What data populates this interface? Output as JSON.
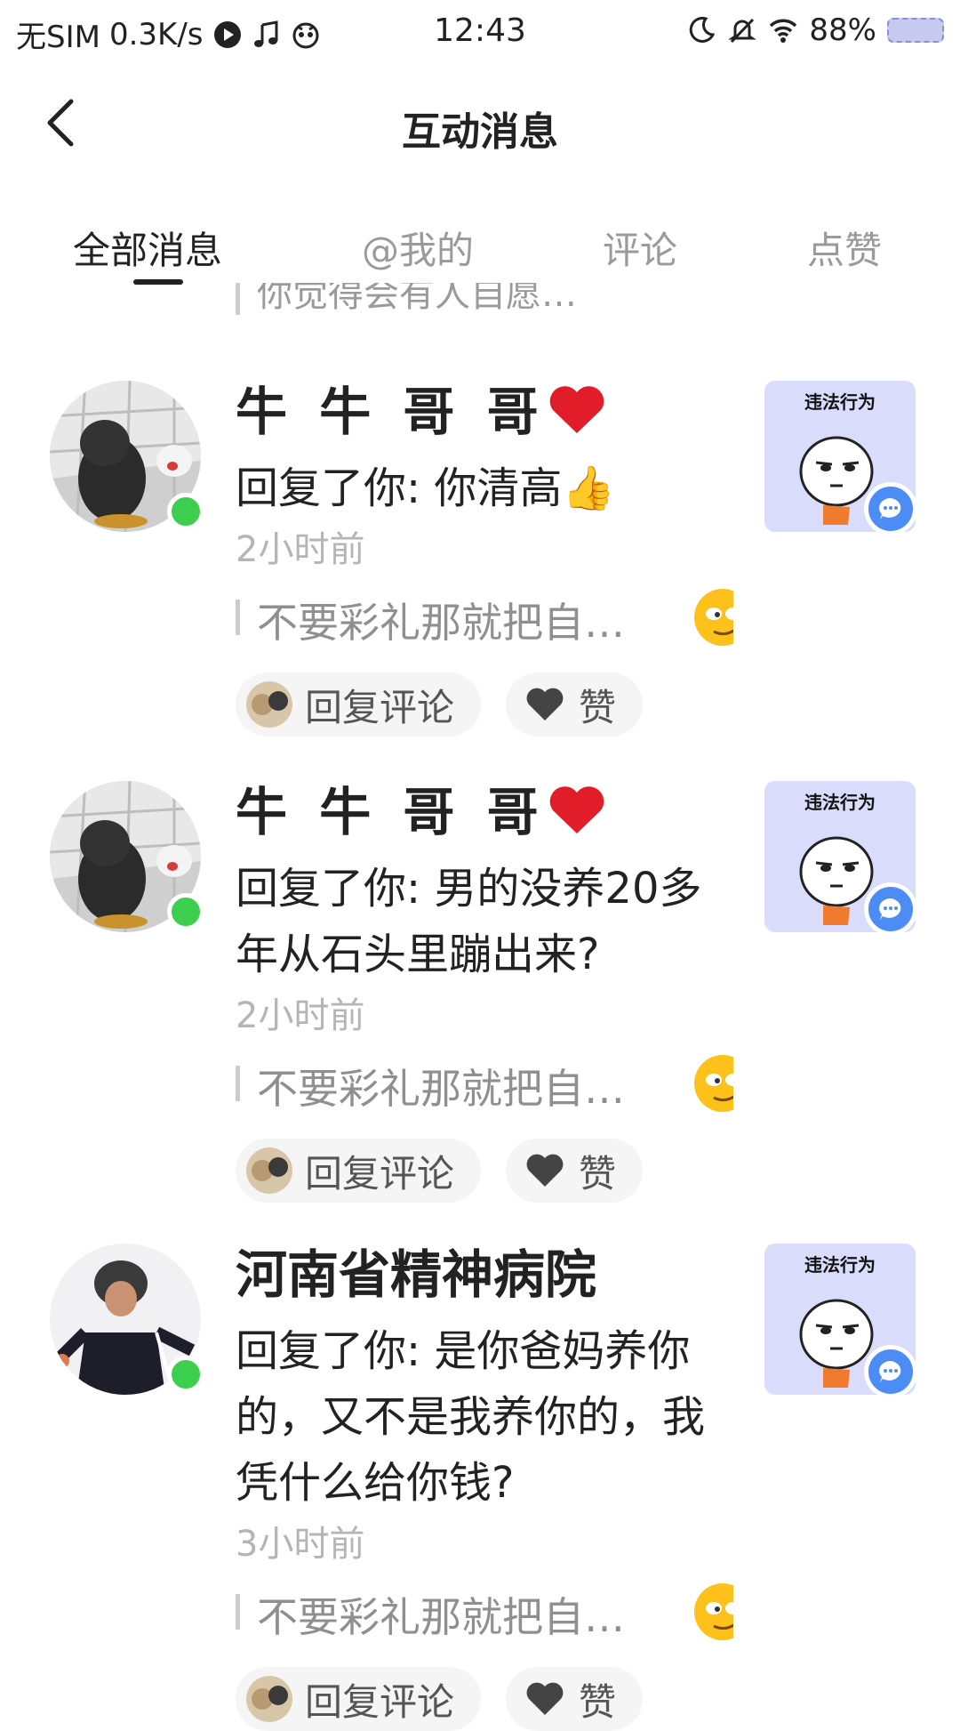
{
  "status_bar": {
    "carrier": "无SIM",
    "speed": "0.3K/s",
    "time": "12:43",
    "battery": "88%"
  },
  "header": {
    "title": "互动消息"
  },
  "tabs": [
    {
      "label": "全部消息",
      "active": true
    },
    {
      "label": "@我的",
      "active": false
    },
    {
      "label": "评论",
      "active": false
    },
    {
      "label": "点赞",
      "active": false
    }
  ],
  "previous_quote": "你觉得会有人自愿…",
  "items": [
    {
      "name": "牛 牛 哥 哥",
      "reply": "回复了你: 你清高👍",
      "time": "2小时前",
      "quote": "不要彩礼那就把自…",
      "thumb_label": "违法行为",
      "reply_button": "回复评论",
      "like_button": "赞"
    },
    {
      "name": "牛 牛 哥 哥",
      "reply": "回复了你: 男的没养20多年从石头里蹦出来?",
      "time": "2小时前",
      "quote": "不要彩礼那就把自…",
      "thumb_label": "违法行为",
      "reply_button": "回复评论",
      "like_button": "赞"
    },
    {
      "name": "河南省精神病院",
      "reply": "回复了你: 是你爸妈养你的，又不是我养你的，我凭什么给你钱?",
      "time": "3小时前",
      "quote": "不要彩礼那就把自…",
      "thumb_label": "违法行为",
      "reply_button": "回复评论",
      "like_button": "赞"
    }
  ],
  "colors": {
    "online": "#3ccf4e",
    "comment_badge": "#4b8df5",
    "thumb_bg": "#d9dcfb"
  }
}
